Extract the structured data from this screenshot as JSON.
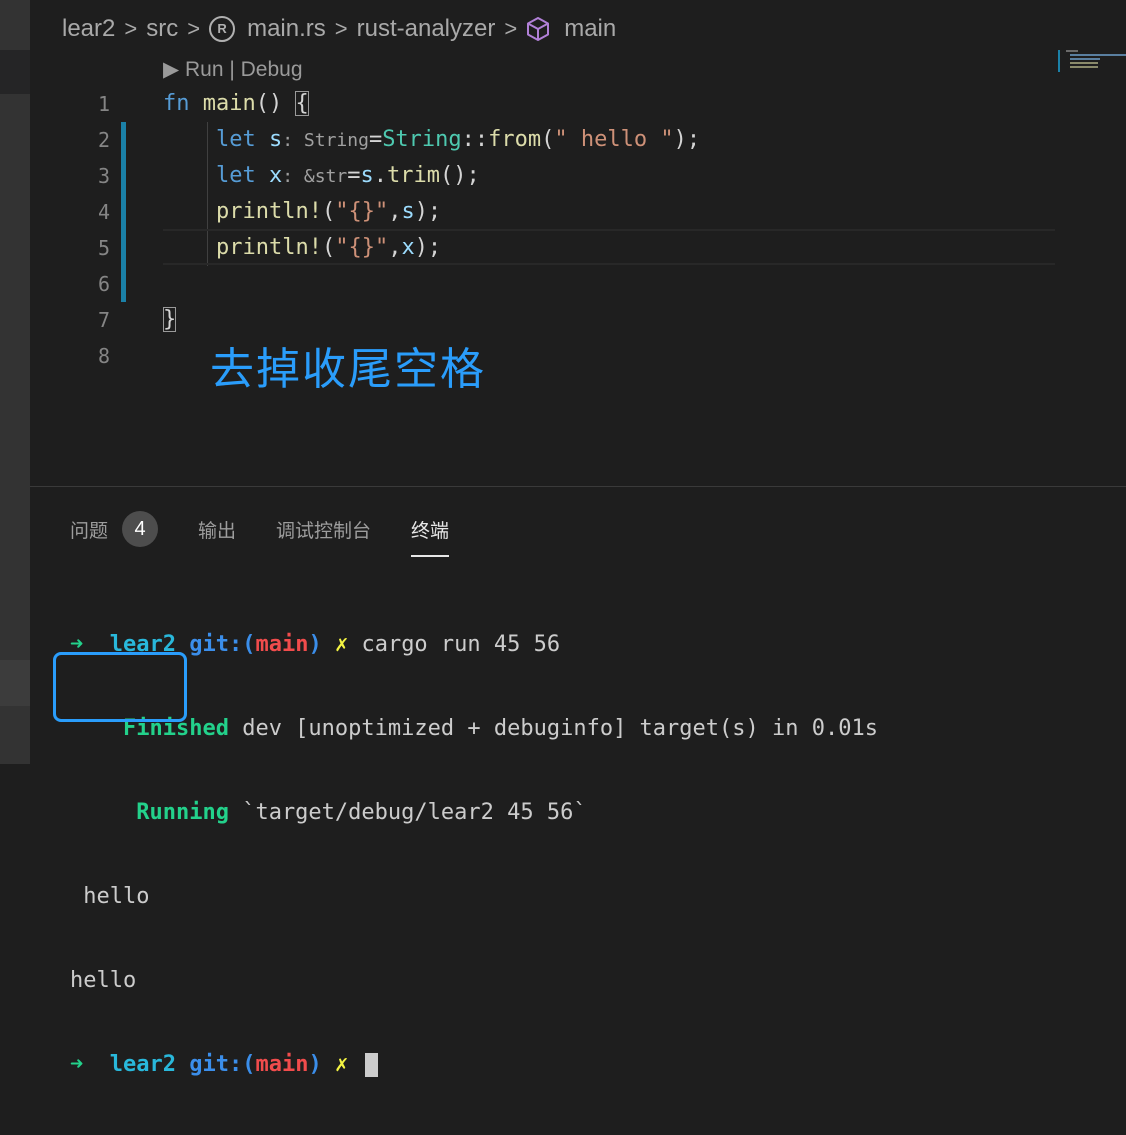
{
  "breadcrumb": {
    "items": [
      "lear2",
      "src",
      "main.rs",
      "rust-analyzer",
      "main"
    ],
    "separator": ">"
  },
  "editor": {
    "codelens": "▶ Run | Debug",
    "line_numbers": [
      "1",
      "2",
      "3",
      "4",
      "5",
      "6",
      "7",
      "8"
    ],
    "code": {
      "l1": {
        "kw": "fn",
        "name": "main",
        "rest": "() ",
        "brace": "{"
      },
      "l2": {
        "kw": "let",
        "var": "s",
        "hint": ": String",
        "eq": "=",
        "ty": "String",
        "sep": "::",
        "fn": "from",
        "open": "(",
        "str": "\" hello \"",
        "close": ");"
      },
      "l3": {
        "kw": "let",
        "var": "x",
        "hint": ": &str",
        "eq": "=",
        "var2": "s",
        "dot": ".",
        "fn": "trim",
        "close": "();"
      },
      "l4": {
        "mac": "println!",
        "open": "(",
        "str": "\"{}\"",
        "comma": ",",
        "var": "s",
        "close": ");"
      },
      "l5": {
        "mac": "println!",
        "open": "(",
        "str": "\"{}\"",
        "comma": ",",
        "var": "x",
        "close": ");"
      },
      "l7": {
        "brace": "}"
      }
    },
    "annotation": "去掉收尾空格"
  },
  "panel": {
    "tabs": [
      {
        "label": "问题",
        "badge": "4"
      },
      {
        "label": "输出"
      },
      {
        "label": "调试控制台"
      },
      {
        "label": "终端"
      }
    ],
    "active_tab": "终端"
  },
  "terminal": {
    "prompt_arrow": "➜",
    "dir": "lear2",
    "git": "git:(",
    "branch": "main",
    "git_close": ")",
    "x_mark": "✗",
    "command": "cargo run 45 56",
    "finished_word": "Finished",
    "finished_rest": "dev [unoptimized + debuginfo] target(s) in 0.01s",
    "running_word": "Running",
    "running_rest": "`target/debug/lear2 45 56`",
    "output_1": " hello ",
    "output_2": "hello"
  },
  "colors": {
    "accent_blue": "#2a9dfb",
    "git_bar": "#1b81a8",
    "terminal_green": "#23d18b",
    "terminal_cyan": "#29b8db",
    "terminal_red": "#f14c4c",
    "terminal_yellow": "#f5f543"
  },
  "icons": [
    "rust-file-icon",
    "cube-symbol-icon",
    "play-icon"
  ]
}
